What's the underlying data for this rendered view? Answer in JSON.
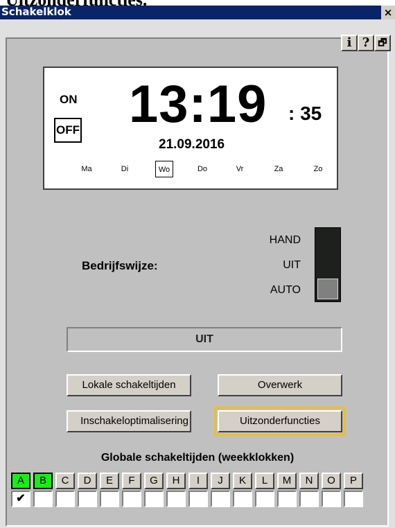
{
  "page_heading": "Uitzonderfuncties.",
  "window": {
    "title": "Schakelklok",
    "close": "×"
  },
  "toolbar": {
    "info": "i",
    "help": "?",
    "restore": "🗗"
  },
  "clock": {
    "on": "ON",
    "off": "OFF",
    "time": "13:19",
    "seconds": ": 35",
    "date": "21.09.2016",
    "days": [
      "Ma",
      "Di",
      "Wo",
      "Do",
      "Vr",
      "Za",
      "Zo"
    ],
    "active_day_index": 2
  },
  "mode": {
    "label": "Bedrijfswijze:",
    "options": [
      "HAND",
      "UIT",
      "AUTO"
    ],
    "selected": "AUTO"
  },
  "status": "UIT",
  "buttons": {
    "local": "Lokale schakeltijden",
    "overtime": "Overwerk",
    "optimization": "Inschakeloptimalisering",
    "exceptions": "Uitzonderfuncties"
  },
  "global": {
    "title": "Globale schakeltijden (weekklokken)",
    "letters": [
      "A",
      "B",
      "C",
      "D",
      "E",
      "F",
      "G",
      "H",
      "I",
      "J",
      "K",
      "L",
      "M",
      "N",
      "O",
      "P"
    ],
    "active_letters": [
      "A",
      "B"
    ],
    "checked": [
      "A"
    ],
    "check_mark": "✔"
  },
  "colors": {
    "titlebar": "#0a246a",
    "active_letter": "#14f014",
    "focus": "#f0c020"
  }
}
